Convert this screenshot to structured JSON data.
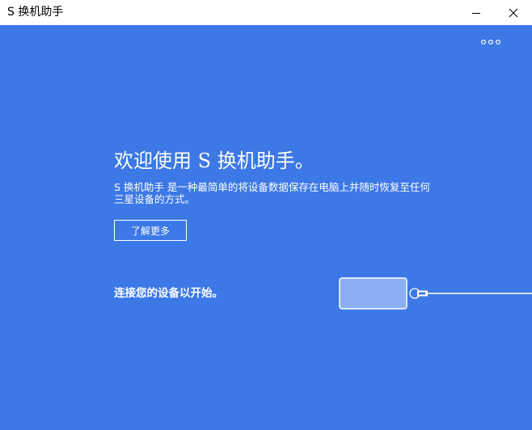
{
  "window": {
    "title": "S 换机助手",
    "minimize_icon": "minimize-icon",
    "close_icon": "close-icon"
  },
  "main": {
    "background_color": "#3c78e6",
    "more_icon": "more-options-icon",
    "heading": "欢迎使用 S 换机助手。",
    "description": "S 换机助手 是一种最简单的将设备数据保存在电脑上并随时恢复至任何三星设备的方式。",
    "learn_more_label": "了解更多",
    "connect_prompt": "连接您的设备以开始。",
    "illustration_icon": "phone-usb-cable-icon"
  }
}
